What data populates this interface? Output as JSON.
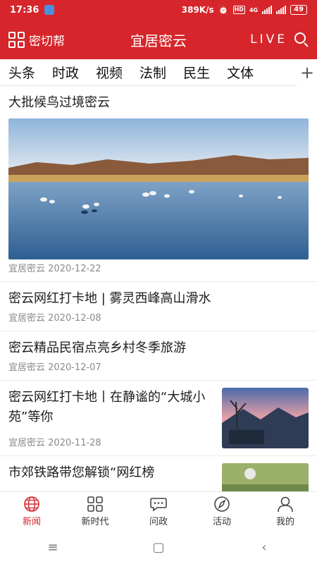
{
  "status_bar": {
    "time": "17:36",
    "network_speed": "389K/s",
    "network_type": "4G",
    "battery": "49"
  },
  "header": {
    "left_label": "密切帮",
    "title": "宜居密云",
    "live_label": "LIVE"
  },
  "tabs": [
    "头条",
    "时政",
    "视频",
    "法制",
    "民生",
    "文体"
  ],
  "tabs_add": "+",
  "feed": [
    {
      "title": "大批候鸟过境密云",
      "source": "宜居密云",
      "date": "2020-12-22",
      "layout": "big-image"
    },
    {
      "title": "密云网红打卡地 | 雾灵西峰高山滑水",
      "source": "宜居密云",
      "date": "2020-12-08",
      "layout": "text"
    },
    {
      "title": "密云精品民宿点亮乡村冬季旅游",
      "source": "宜居密云",
      "date": "2020-12-07",
      "layout": "text"
    },
    {
      "title": "密云网红打卡地丨在静谧的“大城小苑”等你",
      "source": "宜居密云",
      "date": "2020-11-28",
      "layout": "thumb"
    },
    {
      "title": "市郊铁路带您解锁“网红榜",
      "source": "",
      "date": "",
      "layout": "thumb"
    }
  ],
  "bottom_nav": [
    {
      "label": "新闻",
      "icon": "globe-icon",
      "active": true
    },
    {
      "label": "新时代",
      "icon": "grid-icon",
      "active": false
    },
    {
      "label": "问政",
      "icon": "chat-icon",
      "active": false
    },
    {
      "label": "活动",
      "icon": "compass-icon",
      "active": false
    },
    {
      "label": "我的",
      "icon": "person-icon",
      "active": false
    }
  ],
  "system_nav": {
    "menu": "≡",
    "home": "▢",
    "back": "‹"
  },
  "colors": {
    "brand_red": "#d6262b",
    "meta_gray": "#8a8a8a"
  }
}
